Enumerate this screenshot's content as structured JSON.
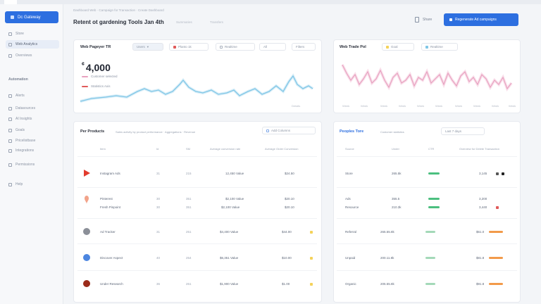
{
  "sidebar": {
    "brand_label": "Dc Gateway",
    "items_top": [
      {
        "label": "Store"
      },
      {
        "label": "Web Analytics"
      },
      {
        "label": "Overviews"
      }
    ],
    "section_label": "Automation",
    "items": [
      {
        "label": "Alerts"
      },
      {
        "label": "Datasources"
      },
      {
        "label": "AI Insights"
      },
      {
        "label": "Goals"
      },
      {
        "label": "Pricelistbase"
      },
      {
        "label": "Integrations"
      },
      {
        "label": "Permissions"
      },
      {
        "label": "Help"
      }
    ]
  },
  "header": {
    "breadcrumb": "Dashboard Web · Campaign for Transaction · Create Dashboard",
    "title": "Retent ot gardening Tools Jan 4th",
    "sub_items": [
      "Summaries",
      "Transfers"
    ],
    "link_label": "Share",
    "primary_label": "Regenerate Ad campaigns"
  },
  "card_left": {
    "title": "Web Pageyer TR",
    "chips": [
      "Users",
      "Planto 1k",
      "Realtime",
      "All",
      "Filters"
    ],
    "big_value": "4,000",
    "legend": [
      "Customer selected",
      "Statistics Axis"
    ],
    "foot": "Details"
  },
  "card_right": {
    "title": "Web Trade Pol",
    "chips": [
      "Goal",
      "Realtime"
    ],
    "x_ticks": [
      "Week",
      "Week",
      "Week",
      "Week",
      "Week",
      "Week",
      "Week",
      "Week",
      "Week",
      "Week"
    ]
  },
  "table_left": {
    "title": "Per Products",
    "subtitle": "Sales activity by product performance · Aggregations · Revenue",
    "button_label": "Add Columns",
    "headers": [
      "Item",
      "Id",
      "SM",
      "Average conversion rate",
      "Average Order Conversion"
    ],
    "rows": [
      {
        "name": "Instagram Ads",
        "sub": "",
        "id": "31",
        "sm": "215",
        "avg": "12,450 Value",
        "order": "$24.50"
      },
      {
        "name": "Pinterest",
        "sub": "Fresh Pinpoint",
        "id": "30",
        "sm": "351",
        "avg": "$2,100 Value",
        "order": "$20.10"
      },
      {
        "name": "Ad Tracker",
        "sub": "",
        "id": "31",
        "sm": "251",
        "avg": "$4,400 Value",
        "order": "$44.00"
      },
      {
        "name": "Discover Aspect",
        "sub": "",
        "id": "40",
        "sm": "254",
        "avg": "$6,351 Value",
        "order": "$10.00"
      },
      {
        "name": "Under Research",
        "sub": "",
        "id": "36",
        "sm": "261",
        "avg": "$1,900 Value",
        "order": "$1.00"
      }
    ]
  },
  "table_right": {
    "title": "Peoples Tore",
    "subtitle": "Customer statistics",
    "chip_label": "Last 7 days",
    "headers": [
      "Source",
      "Under",
      "CTR",
      "Overview for Delete Transaction"
    ],
    "rows": [
      {
        "src": "Store",
        "under": "265.5k",
        "ctr_color": "#4bbf7f",
        "val": "3,145"
      },
      {
        "src": "Ads",
        "sub": "Resource",
        "under": "355.5",
        "under2": "210.3k",
        "ctr_color": "#4bbf7f",
        "val": "3,200",
        "val2": "3,440"
      },
      {
        "src": "Referral",
        "under": "265.55.8k",
        "ctr_color": "#4bbf7f",
        "val": "$61.0"
      },
      {
        "src": "Unpaid",
        "under": "200.11.8k",
        "ctr_color": "#4bbf7f",
        "val": "$81.8"
      },
      {
        "src": "Organic",
        "under": "205.55.8k",
        "ctr_color": "#4bbf7f",
        "val": "$91.8"
      }
    ]
  },
  "colors": {
    "accent": "#2d6fe0",
    "line_blue": "#7fc6e6",
    "line_pink": "#e8a2c0",
    "positive": "#4bbf7f",
    "warn": "#f29a4a"
  }
}
